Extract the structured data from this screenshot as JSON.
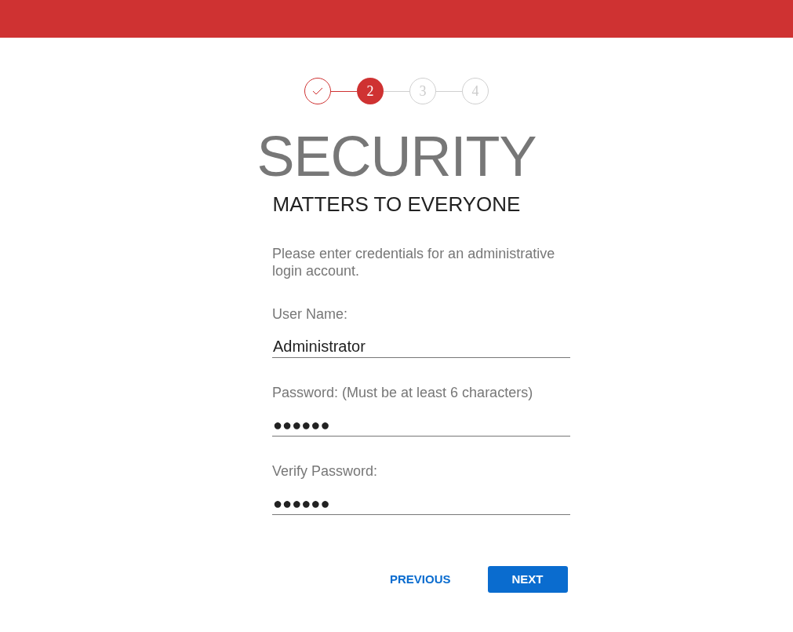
{
  "steps": [
    {
      "completed": true,
      "selected": false
    },
    {
      "label": "2",
      "completed": false,
      "selected": true
    },
    {
      "label": "3",
      "completed": false,
      "selected": false
    },
    {
      "label": "4",
      "completed": false,
      "selected": false
    }
  ],
  "title": "SECURITY",
  "subtitle": "MATTERS TO EVERYONE",
  "instructions": "Please enter credentials for an administrative login account.",
  "fields": [
    {
      "label": "User Name:",
      "value": "Administrator"
    },
    {
      "label": "Password: (Must be at least 6 characters)",
      "value": "●●●●●●"
    },
    {
      "label": "Verify Password:",
      "value": "●●●●●●"
    }
  ],
  "buttons": [
    {
      "label": "PREVIOUS",
      "kind": "text"
    },
    {
      "label": "NEXT",
      "kind": "primary"
    }
  ]
}
